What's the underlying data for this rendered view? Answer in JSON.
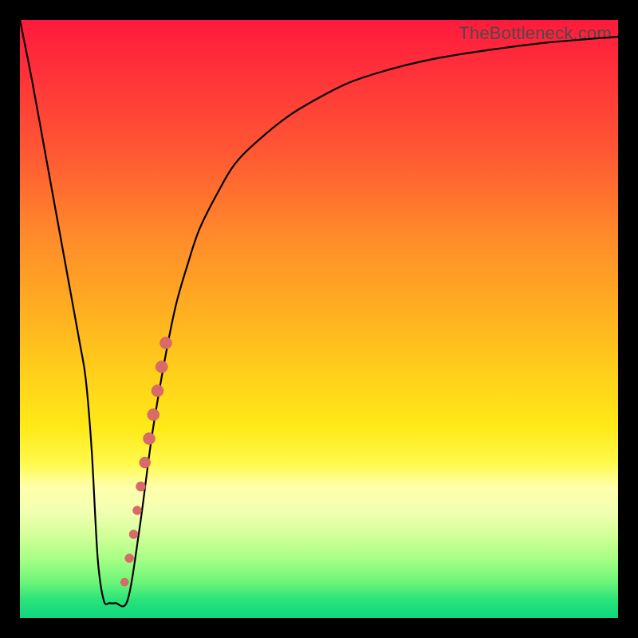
{
  "watermark": "TheBottleneck.com",
  "colors": {
    "frame": "#000000",
    "curve": "#000000",
    "dot_fill": "#d86a6a",
    "dot_stroke": "#c95a5a"
  },
  "chart_data": {
    "type": "line",
    "title": "",
    "xlabel": "",
    "ylabel": "",
    "xlim": [
      0,
      100
    ],
    "ylim": [
      0,
      100
    ],
    "grid": false,
    "legend": false,
    "series": [
      {
        "name": "bottleneck-curve",
        "x": [
          0,
          2,
          4,
          6,
          8,
          10,
          11,
          12,
          13,
          14,
          15,
          16,
          18,
          20,
          22,
          24,
          26,
          28,
          30,
          33,
          36,
          40,
          45,
          50,
          55,
          60,
          66,
          72,
          80,
          88,
          100
        ],
        "y": [
          100,
          90,
          79,
          68,
          57,
          46,
          40,
          28,
          10,
          3,
          2.5,
          2.5,
          3,
          15,
          30,
          42,
          52,
          59,
          65,
          71,
          76,
          80,
          84,
          87,
          89.5,
          91.2,
          92.8,
          94,
          95.2,
          96.2,
          97.2
        ]
      }
    ],
    "scatter": {
      "name": "highlight-dots",
      "points": [
        {
          "x": 17.5,
          "y": 6,
          "r": 5
        },
        {
          "x": 18.3,
          "y": 10,
          "r": 5.5
        },
        {
          "x": 19.0,
          "y": 14,
          "r": 5.5
        },
        {
          "x": 19.6,
          "y": 18,
          "r": 5.5
        },
        {
          "x": 20.2,
          "y": 22,
          "r": 6
        },
        {
          "x": 20.9,
          "y": 26,
          "r": 7
        },
        {
          "x": 21.6,
          "y": 30,
          "r": 7.5
        },
        {
          "x": 22.3,
          "y": 34,
          "r": 7.5
        },
        {
          "x": 23.0,
          "y": 38,
          "r": 7.5
        },
        {
          "x": 23.7,
          "y": 42,
          "r": 7.5
        },
        {
          "x": 24.4,
          "y": 46,
          "r": 7.5
        }
      ]
    },
    "gradient_stops": [
      {
        "pos": 0,
        "color": "#ff1a3c"
      },
      {
        "pos": 50,
        "color": "#ffd21a"
      },
      {
        "pos": 78,
        "color": "#ffffaa"
      },
      {
        "pos": 100,
        "color": "#0fd77d"
      }
    ]
  }
}
